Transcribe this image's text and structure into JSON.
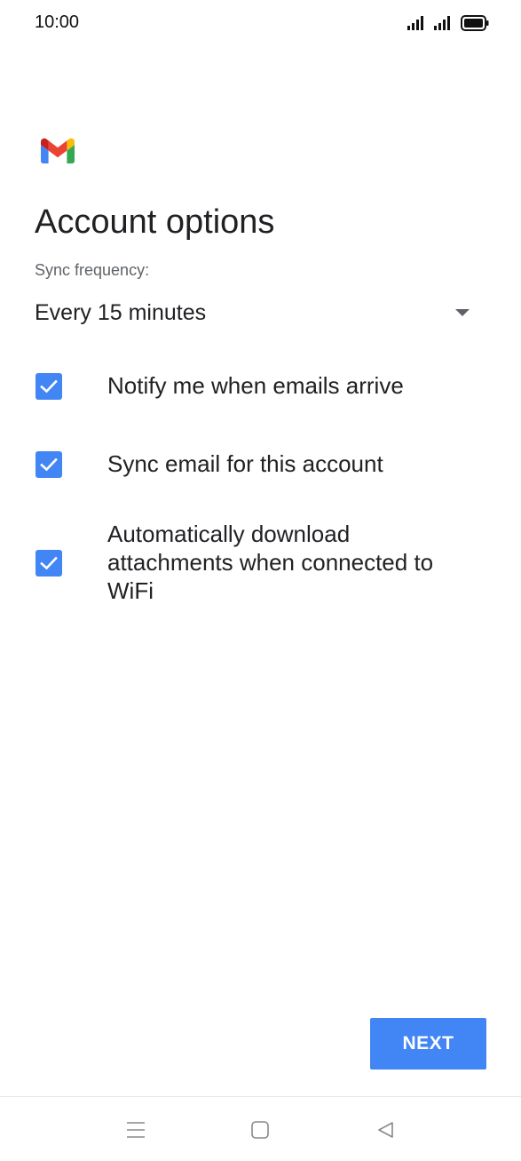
{
  "status_bar": {
    "time": "10:00",
    "icons": [
      "signal-icon",
      "signal-icon",
      "battery-icon"
    ]
  },
  "app": {
    "logo": "gmail-logo"
  },
  "page": {
    "title": "Account options"
  },
  "sync": {
    "label": "Sync frequency:",
    "selected": "Every 15 minutes"
  },
  "options": [
    {
      "label": "Notify me when emails arrive",
      "checked": true
    },
    {
      "label": "Sync email for this account",
      "checked": true
    },
    {
      "label": "Automatically download attachments when connected to WiFi",
      "checked": true
    }
  ],
  "actions": {
    "next_label": "NEXT"
  },
  "colors": {
    "accent": "#4285f4",
    "text_primary": "#202124",
    "text_secondary": "#5f6368"
  },
  "nav_bar": {
    "icons": [
      "menu-icon",
      "home-icon",
      "back-icon"
    ]
  }
}
